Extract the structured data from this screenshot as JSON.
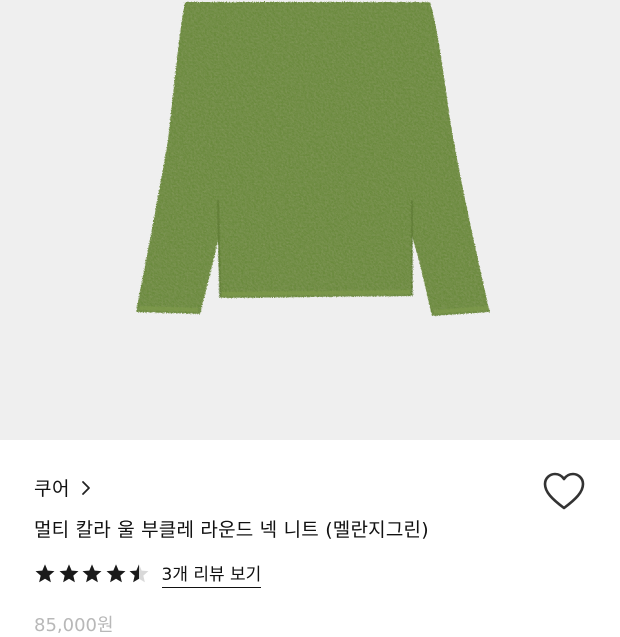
{
  "product": {
    "image_alt": "green boucle round neck knit sweater",
    "main_color": "#6b8a3c",
    "background_color": "#efefef"
  },
  "brand": {
    "name": "쿠어",
    "chevron_icon": "chevron-right-icon"
  },
  "wishlist": {
    "icon": "heart-outline-icon"
  },
  "title": "멀티 칼라 울 부클레 라운드 넥 니트 (멜란지그린)",
  "rating": {
    "value": 4.5,
    "max": 5,
    "review_link": "3개 리뷰 보기"
  },
  "price": {
    "text": "85,000원"
  }
}
